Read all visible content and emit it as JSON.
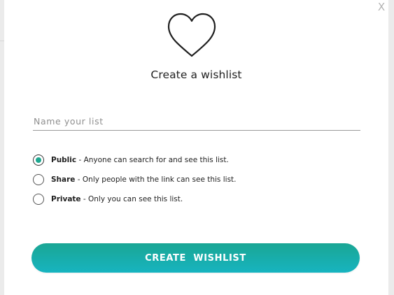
{
  "dialog": {
    "close_label": "X",
    "title": "Create a wishlist",
    "icon": "heart-outline-icon",
    "name_input": {
      "placeholder": "Name your list",
      "value": ""
    },
    "privacy_options": [
      {
        "label": "Public",
        "description": " - Anyone can search for and see this list.",
        "selected": true
      },
      {
        "label": "Share",
        "description": " - Only people with the link can see this list.",
        "selected": false
      },
      {
        "label": "Private",
        "description": " - Only you can see this list.",
        "selected": false
      }
    ],
    "submit_label": "CREATE  WISHLIST"
  },
  "colors": {
    "accent": "#1ea890",
    "button_gradient_start": "#1aa694",
    "button_gradient_end": "#17b4c0"
  }
}
